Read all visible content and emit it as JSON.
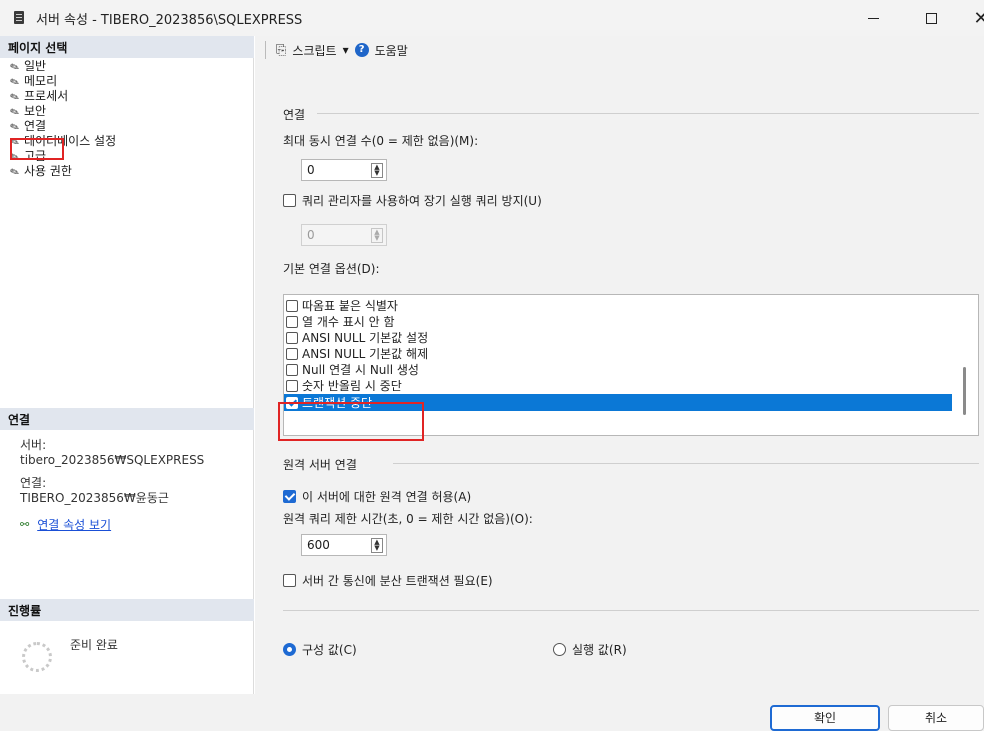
{
  "window": {
    "title": "서버 속성 - TIBERO_2023856\\SQLEXPRESS",
    "minimize_glyph": "",
    "maximize_glyph": "",
    "close_glyph": "✕"
  },
  "left_pane": {
    "page_select_header": "페이지 선택",
    "pages": [
      {
        "label": "일반",
        "icon": "wrench-icon"
      },
      {
        "label": "메모리",
        "icon": "wrench-icon"
      },
      {
        "label": "프로세서",
        "icon": "wrench-icon"
      },
      {
        "label": "보안",
        "icon": "wrench-icon"
      },
      {
        "label": "연결",
        "icon": "wrench-icon"
      },
      {
        "label": "데이터베이스 설정",
        "icon": "wrench-icon"
      },
      {
        "label": "고급",
        "icon": "wrench-icon"
      },
      {
        "label": "사용 권한",
        "icon": "wrench-icon"
      }
    ],
    "selected_page": "연결",
    "connection_header": "연결",
    "server_label": "서버:",
    "server_value": "tibero_2023856₩SQLEXPRESS",
    "connection_label": "연결:",
    "connection_value": "TIBERO_2023856₩윤동근",
    "view_connection_properties": "연결 속성 보기",
    "progress_header": "진행률",
    "progress_status": "준비 완료"
  },
  "toolbar": {
    "script_label": "스크립트",
    "script_dropdown": "▾",
    "help_label": "도움말",
    "help_glyph": "?"
  },
  "connections": {
    "group_title": "연결",
    "max_concurrent_label": "최대 동시 연결 수(0 = 제한 없음)(M):",
    "max_concurrent_value": "0",
    "use_query_governor_label": "쿼리 관리자를 사용하여 장기 실행 쿼리 방지(U)",
    "use_query_governor_checked": false,
    "query_governor_value": "0",
    "default_options_label": "기본 연결 옵션(D):",
    "default_options": [
      {
        "label": "따옴표 붙은 식별자",
        "checked": false
      },
      {
        "label": "열 개수 표시 안 함",
        "checked": false
      },
      {
        "label": "ANSI NULL 기본값 설정",
        "checked": false
      },
      {
        "label": "ANSI NULL 기본값 해제",
        "checked": false
      },
      {
        "label": "Null 연결 시 Null 생성",
        "checked": false
      },
      {
        "label": "숫자 반올림 시 중단",
        "checked": false
      },
      {
        "label": "트랜잭션 중단",
        "checked": true,
        "selected": true
      }
    ]
  },
  "remote": {
    "group_title": "원격 서버 연결",
    "allow_remote_label": "이 서버에 대한 원격 연결 허용(A)",
    "allow_remote_checked": true,
    "remote_timeout_label": "원격 쿼리 제한 시간(초, 0 = 제한 시간 없음)(O):",
    "remote_timeout_value": "600",
    "distributed_tx_label": "서버 간 통신에 분산 트랜잭션 필요(E)",
    "distributed_tx_checked": false
  },
  "value_mode": {
    "configured_label": "구성 값(C)",
    "running_label": "실행 값(R)",
    "selected": "configured"
  },
  "buttons": {
    "ok": "확인",
    "cancel": "취소"
  },
  "colors": {
    "accent": "#1e6ad3",
    "selection": "#0b78d6",
    "highlight_box": "#e02424",
    "section_header": "#e1e6ee"
  }
}
